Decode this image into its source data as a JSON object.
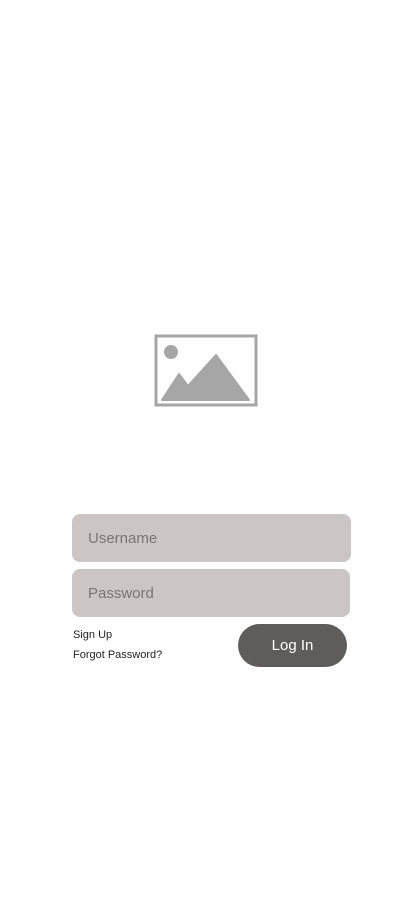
{
  "logo": {
    "icon": "image-placeholder-icon",
    "color": "#a6a6a6"
  },
  "form": {
    "username_placeholder": "Username",
    "password_placeholder": "Password",
    "signup_label": "Sign Up",
    "forgot_label": "Forgot Password?",
    "login_label": "Log In"
  },
  "colors": {
    "field_background": "#cbc5c3",
    "button_background": "#5f5d5a",
    "button_text": "#ffffff"
  }
}
